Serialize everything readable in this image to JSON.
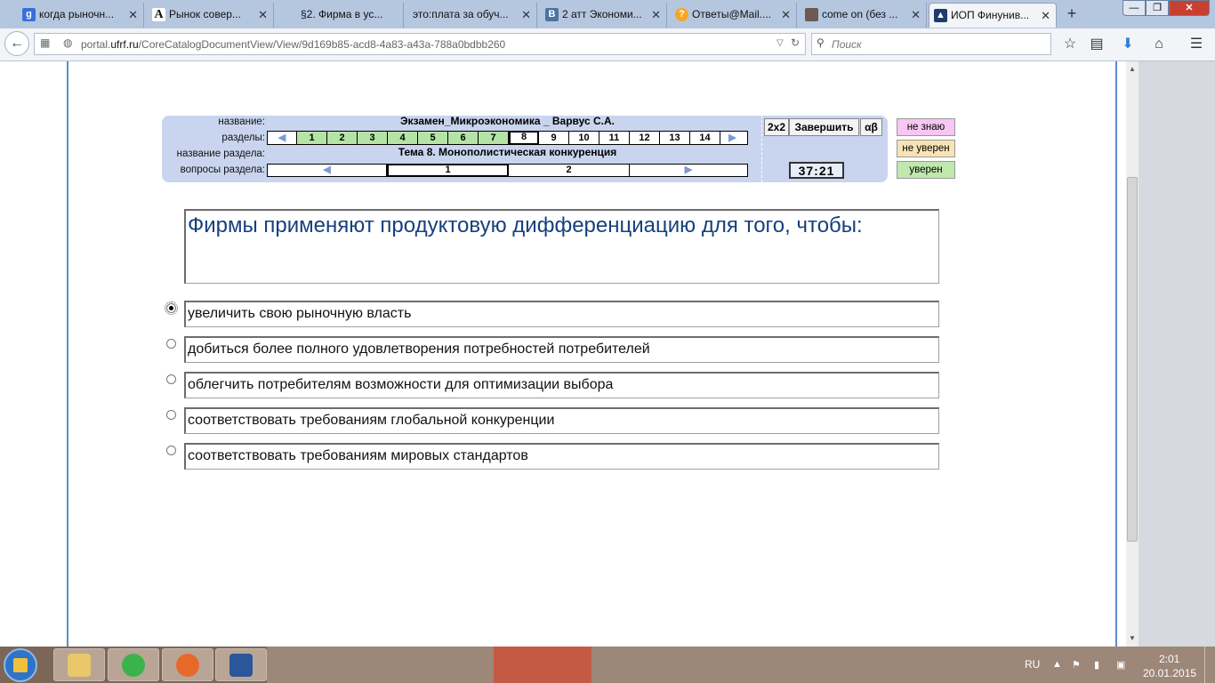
{
  "browser": {
    "tabs": [
      {
        "label": "когда рыночн...",
        "icon": "google-icon",
        "color": "#3b6fd8"
      },
      {
        "label": "Рынок совер...",
        "icon": "letter-a-icon",
        "color": "#222222"
      },
      {
        "label": "§2. Фирма в ус...",
        "icon": "blank-page-icon",
        "color": ""
      },
      {
        "label": "это:плата за обуч...",
        "icon": "blank-page-icon",
        "color": ""
      },
      {
        "label": "2 атт Экономи...",
        "icon": "vk-icon",
        "color": "#4b73a3"
      },
      {
        "label": "Ответы@Mail....",
        "icon": "mail-answers-icon",
        "color": "#f5a623"
      },
      {
        "label": "come on (без ...",
        "icon": "photo-icon",
        "color": "#6b5a55"
      },
      {
        "label": "ИОП Финунив...",
        "icon": "graduation-cap-icon",
        "color": "#1d3d6e"
      }
    ],
    "new_tab": "+",
    "url_prefix": "portal.",
    "url_domain": "ufrf.ru",
    "url_path": "/CoreCatalogDocumentView/View/9d169b85-acd8-4a83-a43a-788a0bdbb260",
    "search_placeholder": "Поиск"
  },
  "exam": {
    "labels": {
      "name": "название:",
      "sections": "разделы:",
      "section_name": "название раздела:",
      "section_questions": "вопросы раздела:"
    },
    "title": "Экзамен_Микроэкономика _ Варвус С.А.",
    "section_title": "Тема   8. Монополистическая конкуренция",
    "sections": [
      "1",
      "2",
      "3",
      "4",
      "5",
      "6",
      "7",
      "8",
      "9",
      "10",
      "11",
      "12",
      "13",
      "14"
    ],
    "completed_sections": 7,
    "current_section": "8",
    "questions": [
      "1",
      "2"
    ],
    "current_question": "1",
    "btn_2x2": "2x2",
    "btn_finish": "Завершить",
    "btn_alphabeta": "αβ",
    "timer": "37:21",
    "confidence": {
      "dont_know": "не знаю",
      "not_sure": "не уверен",
      "sure": "уверен"
    },
    "confidence_colors": {
      "dont_know": "#f7c6f2",
      "not_sure": "#f8e3b5",
      "sure": "#bfe7ae"
    }
  },
  "question": {
    "text": "Фирмы применяют продуктовую дифференциацию для того, чтобы:",
    "options": [
      "увеличить свою рыночную власть",
      "добиться более полного удовлетворения потребностей потребителей",
      "облегчить потребителям возможности для оптимизации выбора",
      "соответствовать требованиям глобальной конкуренции",
      "соответствовать требованиям мировых стандартов"
    ],
    "selected_index": 0
  },
  "taskbar": {
    "lang": "RU",
    "time": "2:01",
    "date": "20.01.2015"
  }
}
